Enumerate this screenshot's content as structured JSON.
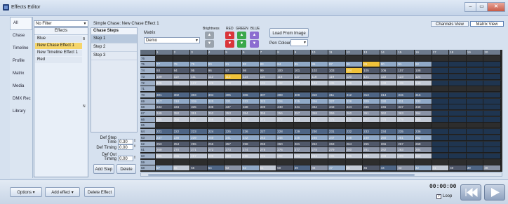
{
  "window": {
    "title": "Effects Editor",
    "buttons": [
      "–",
      "▭",
      "✕"
    ]
  },
  "nav": {
    "items": [
      "All",
      "Chase",
      "Timeline",
      "Profile",
      "Matrix",
      "Media",
      "DMX Rec",
      "Library"
    ],
    "selected": 0
  },
  "filter": {
    "value": "No Filter"
  },
  "effects": {
    "header": "Effects",
    "items": [
      "Blue",
      "New Chase Effect 1",
      "New Timeline Effect 1",
      "Red"
    ],
    "selected": 1,
    "side_letters": [
      "B",
      "N"
    ]
  },
  "chase": {
    "title": "Simple Chase: New Chase Effect 1",
    "steps_header": "Chase Steps",
    "steps": [
      "Step 1",
      "Step 2",
      "Step 3"
    ],
    "def_step_time_label": "Def Step Time",
    "def_step_time": "0.30",
    "def_timing_label": "Def Timing",
    "def_timing": "0.00",
    "def_out_timing_label": "Def Out Timing",
    "def_out_timing": "0.00",
    "add_step": "Add Step",
    "delete": "Delete"
  },
  "matrix": {
    "label": "Matrix",
    "value": "Demo",
    "brightness_label": "Brightness",
    "red_label": "RED",
    "green_label": "GREEN",
    "blue_label": "BLUE",
    "load_image": "Load From Image",
    "pen_colour_label": "Pen Colour",
    "channels_view": "Channels View",
    "matrix_view": "Matrix View"
  },
  "grid": {
    "col_headers": [
      "1",
      "2",
      "3",
      "4",
      "5",
      "6",
      "7",
      "8",
      "9",
      "10",
      "11",
      "12",
      "13",
      "14",
      "15",
      "16",
      "17",
      "18",
      "19",
      "20"
    ],
    "rows": [
      {
        "label": "76",
        "cells": [
          "",
          "",
          "",
          "",
          "",
          "",
          "",
          "",
          "",
          "",
          "",
          "",
          "",
          "",
          "",
          "",
          "",
          "",
          "",
          ""
        ]
      },
      {
        "label": "75",
        "cells": [
          "77",
          "78",
          "79",
          "80",
          "81",
          "82",
          "83",
          "84",
          "85",
          "86",
          "87",
          "88",
          "89",
          "90",
          "91",
          "92",
          "",
          "",
          "",
          ""
        ]
      },
      {
        "label": "74",
        "cells": [
          "93",
          "94",
          "95",
          "96",
          "97",
          "98",
          "99",
          "100",
          "101",
          "102",
          "103",
          "104",
          "105",
          "106",
          "107",
          "108",
          "",
          "",
          "",
          ""
        ]
      },
      {
        "label": "73",
        "cells": [
          "109",
          "110",
          "111",
          "112",
          "113",
          "114",
          "115",
          "116",
          "117",
          "118",
          "119",
          "120",
          "121",
          "122",
          "123",
          "124",
          "",
          "",
          "",
          ""
        ]
      },
      {
        "label": "72",
        "cells": [
          "125",
          "126",
          "127",
          "128",
          "129",
          "130",
          "131",
          "132",
          "133",
          "134",
          "135",
          "136",
          "137",
          "138",
          "139",
          "140",
          "",
          "",
          "",
          ""
        ]
      },
      {
        "label": "71",
        "cells": [
          "",
          "",
          "",
          "",
          "",
          "",
          "",
          "",
          "",
          "",
          "",
          "",
          "",
          "",
          "",
          "",
          "",
          "",
          "",
          ""
        ]
      },
      {
        "label": "70",
        "cells": [
          "301",
          "302",
          "303",
          "304",
          "305",
          "306",
          "307",
          "308",
          "309",
          "310",
          "311",
          "312",
          "313",
          "314",
          "315",
          "316",
          "",
          "",
          "",
          ""
        ]
      },
      {
        "label": "69",
        "cells": [
          "317",
          "318",
          "319",
          "320",
          "321",
          "322",
          "323",
          "324",
          "325",
          "326",
          "327",
          "328",
          "329",
          "330",
          "331",
          "332",
          "",
          "",
          "",
          ""
        ]
      },
      {
        "label": "68",
        "cells": [
          "333",
          "334",
          "335",
          "336",
          "337",
          "338",
          "339",
          "340",
          "341",
          "342",
          "343",
          "344",
          "345",
          "346",
          "347",
          "348",
          "",
          "",
          "",
          ""
        ]
      },
      {
        "label": "67",
        "cells": [
          "349",
          "350",
          "351",
          "352",
          "353",
          "354",
          "355",
          "356",
          "357",
          "358",
          "359",
          "360",
          "361",
          "362",
          "363",
          "364",
          "",
          "",
          "",
          ""
        ]
      },
      {
        "label": "66",
        "cells": [
          "365",
          "366",
          "367",
          "368",
          "369",
          "370",
          "371",
          "372",
          "373",
          "374",
          "375",
          "376",
          "377",
          "378",
          "379",
          "380",
          "",
          "",
          "",
          ""
        ]
      },
      {
        "label": "65",
        "cells": [
          "",
          "",
          "",
          "",
          "",
          "",
          "",
          "",
          "",
          "",
          "",
          "",
          "",
          "",
          "",
          "",
          "",
          "",
          "",
          ""
        ]
      },
      {
        "label": "64",
        "cells": [
          "221",
          "222",
          "223",
          "224",
          "225",
          "226",
          "227",
          "228",
          "229",
          "230",
          "231",
          "232",
          "233",
          "234",
          "235",
          "236",
          "",
          "",
          "",
          ""
        ]
      },
      {
        "label": "63",
        "cells": [
          "237",
          "238",
          "239",
          "240",
          "241",
          "242",
          "243",
          "244",
          "245",
          "246",
          "247",
          "248",
          "249",
          "250",
          "251",
          "252",
          "",
          "",
          "",
          ""
        ]
      },
      {
        "label": "62",
        "cells": [
          "253",
          "254",
          "255",
          "256",
          "257",
          "258",
          "259",
          "260",
          "261",
          "262",
          "263",
          "264",
          "265",
          "266",
          "267",
          "268",
          "",
          "",
          "",
          ""
        ]
      },
      {
        "label": "61",
        "cells": [
          "269",
          "270",
          "271",
          "272",
          "273",
          "274",
          "275",
          "276",
          "277",
          "278",
          "279",
          "280",
          "281",
          "282",
          "283",
          "284",
          "",
          "",
          "",
          ""
        ]
      },
      {
        "label": "60",
        "cells": [
          "285",
          "286",
          "287",
          "288",
          "289",
          "290",
          "291",
          "292",
          "293",
          "294",
          "295",
          "296",
          "297",
          "298",
          "299",
          "300",
          "",
          "",
          "",
          ""
        ]
      },
      {
        "label": "59",
        "cells": [
          "",
          "",
          "",
          "",
          "",
          "",
          "",
          "",
          "",
          "",
          "",
          "",
          "",
          "",
          "",
          "",
          "",
          "",
          "",
          ""
        ]
      },
      {
        "label": "58",
        "cells": [
          "57",
          "56",
          "55",
          "54",
          "53",
          "52",
          "51",
          "50",
          "49",
          "48",
          "47",
          "46",
          "45",
          "44",
          "43",
          "42",
          "41",
          "40",
          "39",
          "38"
        ]
      }
    ]
  },
  "bottom": {
    "options": "Options",
    "add_effect": "Add effect",
    "delete_effect": "Delete Effect",
    "time": "00:00:00",
    "loop": "Loop"
  },
  "colors": {
    "grid_bg": "#2a2a2a",
    "highlight_yellow": "#f0c23a",
    "brightness_btn": "#9aa3ad",
    "red_btn": "#d9353a",
    "green_btn": "#3aa84a",
    "blue_btn": "#8b6dd0"
  }
}
